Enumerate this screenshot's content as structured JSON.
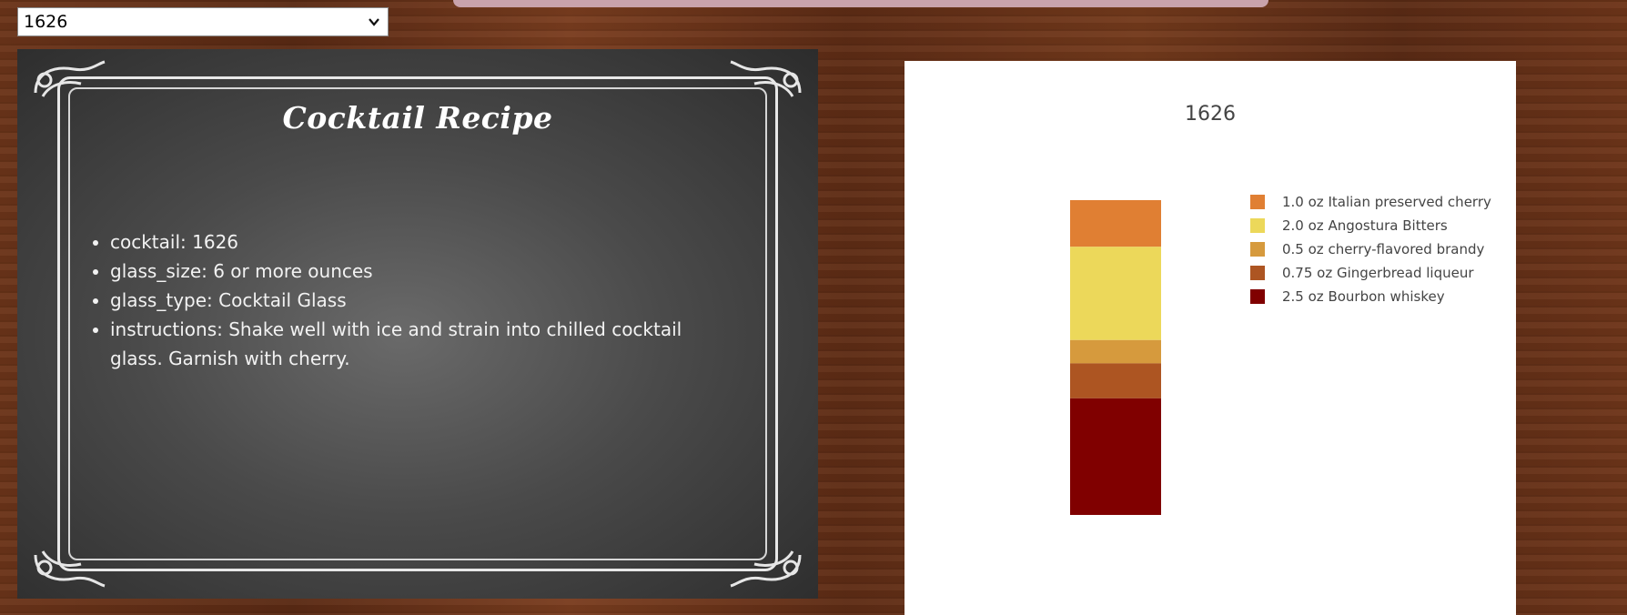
{
  "selector": {
    "selected": "1626"
  },
  "recipe_card": {
    "title": "Cocktail Recipe",
    "items": [
      "cocktail: 1626",
      "glass_size: 6 or more ounces",
      "glass_type: Cocktail Glass",
      "instructions: Shake well with ice and strain into chilled cocktail glass. Garnish with cherry."
    ]
  },
  "chart_data": {
    "type": "bar",
    "stacked": true,
    "title": "1626",
    "categories": [
      ""
    ],
    "unit": "oz",
    "series": [
      {
        "name": "1.0 oz  Italian preserved cherry",
        "values": [
          1.0
        ],
        "color": "#e07f33"
      },
      {
        "name": "2.0 oz  Angostura Bitters",
        "values": [
          2.0
        ],
        "color": "#ecd85a"
      },
      {
        "name": "0.5 oz  cherry-flavored brandy",
        "values": [
          0.5
        ],
        "color": "#d69a3d"
      },
      {
        "name": "0.75 oz  Gingerbread liqueur",
        "values": [
          0.75
        ],
        "color": "#ad5522"
      },
      {
        "name": "2.5 oz  Bourbon whiskey",
        "values": [
          2.5
        ],
        "color": "#800000"
      }
    ],
    "legend_position": "right",
    "grid": false,
    "axes_visible": false
  }
}
